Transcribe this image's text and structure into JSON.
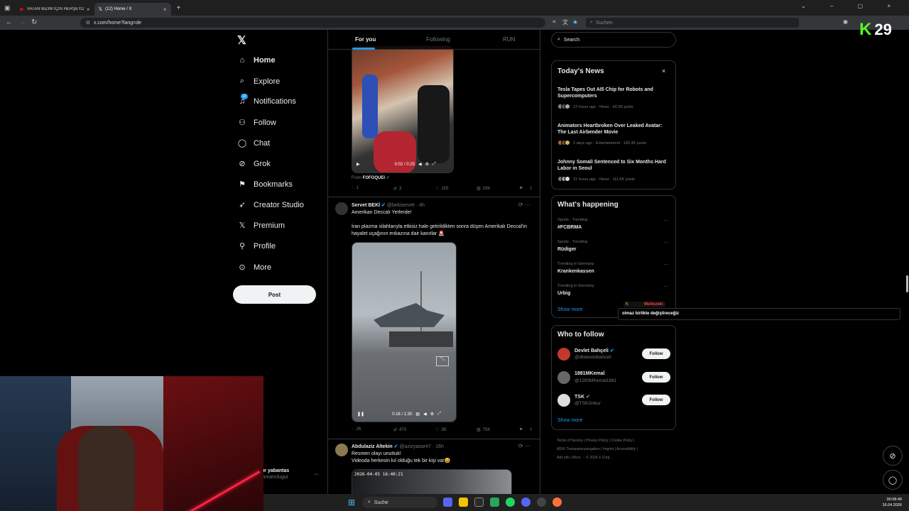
{
  "browser": {
    "tabs": [
      {
        "label": "VATAN BİZİM İÇİN HERŞEYDEN"
      },
      {
        "label": "(12) Home / X"
      }
    ],
    "url": "x.com/home?lang=de",
    "search_placeholder": "Suchen"
  },
  "overlay": {
    "kick_count": "29",
    "chat_user": "Mellozeki",
    "chat_message": "olmaz birlikte değiştireceğiz"
  },
  "sidebar": {
    "items": [
      {
        "label": "Home"
      },
      {
        "label": "Explore"
      },
      {
        "label": "Notifications",
        "badge": "12"
      },
      {
        "label": "Follow"
      },
      {
        "label": "Chat"
      },
      {
        "label": "Grok"
      },
      {
        "label": "Bookmarks"
      },
      {
        "label": "Creator Studio"
      },
      {
        "label": "Premium"
      },
      {
        "label": "Profile"
      },
      {
        "label": "More"
      }
    ],
    "post_label": "Post",
    "user_name": "ur yabantas",
    "user_handle": "lamanclugur"
  },
  "feed": {
    "tabs": [
      "For you",
      "Following",
      "RUN"
    ],
    "tweet1": {
      "video_time": "0:02 / 0:25",
      "from_label": "From",
      "from_name": "FOFOQUEI",
      "replies": "1",
      "reposts": "3",
      "likes": "155",
      "views": "19K"
    },
    "tweet2": {
      "name": "Servet BEKİ",
      "handle": "@bekiservet · 4h",
      "line1": "Amerikan Deccalı Yerlerde!",
      "line2": "İran plazma silahlarıyla etkisiz hale getirildikten sonra düşen Amerikalı Deccal'in hayalet uçağının enkazına dair kanıtlar 🚨",
      "video_time": "0:16 / 1:30",
      "replies": "26",
      "reposts": "470",
      "likes": "3K",
      "views": "75K"
    },
    "tweet3": {
      "name": "Abdulaziz Altekin",
      "handle": "@azizyazar47 · 16h",
      "line1": "Resmen olayı unuttuk!",
      "line2": "Videoda herkesin kıl olduğu tek bir kişi var😆",
      "video_stamp": "2026-04-05 16:40:21"
    }
  },
  "right": {
    "search_placeholder": "Search",
    "news_title": "Today's News",
    "news": [
      {
        "title": "Tesla Tapes Out AI5 Chip for Robots and Supercomputers",
        "meta": "13 hours ago · News · 42.3K posts"
      },
      {
        "title": "Animators Heartbroken Over Leaked Avatar: The Last Airbender Movie",
        "meta": "2 days ago · Entertainment · 183.4K posts"
      },
      {
        "title": "Johnny Somali Sentenced to Six Months Hard Labor in Seoul",
        "meta": "21 hours ago · News · 111.6K posts"
      }
    ],
    "happening_title": "What's happening",
    "trends": [
      {
        "meta": "Sports · Trending",
        "name": "#FCBRMA"
      },
      {
        "meta": "Sports · Trending",
        "name": "Rüdiger"
      },
      {
        "meta": "Trending in Germany",
        "name": "Krankenkassen"
      },
      {
        "meta": "Trending in Germany",
        "name": "Urbig"
      }
    ],
    "show_more": "Show more",
    "wtf_title": "Who to follow",
    "wtf": [
      {
        "name": "Devlet Bahçeli",
        "handle": "@dbdevletbahceli",
        "btn": "Follow"
      },
      {
        "name": "1881MKemal",
        "handle": "@1283MKemal1881",
        "btn": "Follow"
      },
      {
        "name": "TSK",
        "handle": "@TSKGnkur",
        "btn": "Follow"
      }
    ],
    "footer1": "Terms of Service  |  Privacy Policy  |  Cookie Policy  |",
    "footer2": "MStV Transparenzangaben  |  Imprint  |  Accessibility  |",
    "footer3": "Ads info  |  More ···  © 2026 X Corp."
  },
  "taskbar": {
    "search": "Suche",
    "time": "00:08:49",
    "date": "16.04.2026"
  }
}
